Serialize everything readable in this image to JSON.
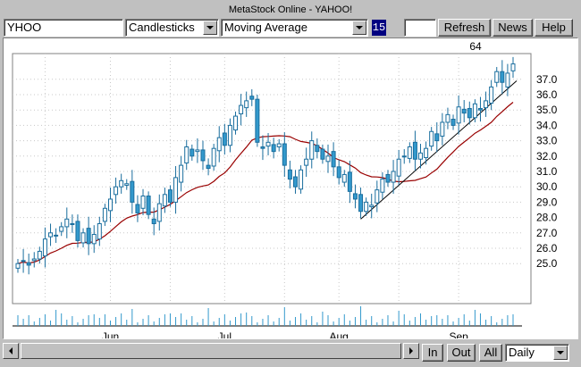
{
  "window": {
    "title": "MetaStock Online - YAHOO!"
  },
  "toolbar": {
    "symbol": "YHOO",
    "chart_style": "Candlesticks",
    "indicator": "Moving Average",
    "period": "15",
    "extra_value": "",
    "refresh_label": "Refresh",
    "news_label": "News",
    "help_label": "Help"
  },
  "footer": {
    "zoom_in_label": "In",
    "zoom_out_label": "Out",
    "all_label": "All",
    "interval": "Daily"
  },
  "colors": {
    "candle_up": "#ffffff",
    "candle_down": "#3399cc",
    "candle_outline": "#1a6e9e",
    "moving_average": "#990000",
    "trendline": "#000000",
    "grid": "#c8c8c8",
    "volume": "#3399cc"
  },
  "chart_data": {
    "type": "candlestick",
    "symbol": "YHOO",
    "interval": "Daily",
    "overlay": {
      "type": "moving_average",
      "period": 15
    },
    "period_label": "64",
    "x_tick_labels": [
      "Jun",
      "Jul",
      "Aug",
      "Sep"
    ],
    "y_ticks": [
      25.0,
      26.0,
      27.0,
      28.0,
      29.0,
      30.0,
      31.0,
      32.0,
      33.0,
      34.0,
      35.0,
      36.0,
      37.0
    ],
    "y_tick_labels": [
      "25.0",
      "26.0",
      "27.0",
      "28.0",
      "29.0",
      "30.0",
      "31.0",
      "32.0",
      "33.0",
      "34.0",
      "35.0",
      "36.0",
      "37.0"
    ],
    "ylim": [
      23.5,
      38.5
    ],
    "grid": true,
    "close": [
      25.0,
      25.2,
      24.9,
      25.3,
      25.8,
      26.6,
      27.0,
      26.8,
      27.4,
      27.9,
      27.6,
      26.5,
      27.0,
      26.3,
      26.9,
      27.6,
      28.6,
      29.2,
      30.0,
      30.4,
      30.2,
      29.0,
      28.3,
      29.4,
      28.2,
      27.6,
      28.9,
      29.5,
      29.0,
      30.6,
      31.4,
      32.6,
      32.0,
      32.4,
      31.7,
      31.2,
      32.5,
      33.2,
      32.7,
      34.0,
      34.6,
      35.3,
      35.6,
      35.7,
      32.9,
      32.5,
      32.9,
      32.3,
      32.8,
      31.4,
      30.5,
      30.0,
      31.1,
      31.8,
      33.0,
      32.3,
      31.8,
      32.0,
      31.3,
      30.6,
      30.8,
      29.7,
      29.2,
      28.4,
      29.0,
      28.8,
      29.8,
      30.5,
      30.3,
      31.0,
      31.8,
      32.0,
      32.6,
      31.8,
      32.2,
      32.5,
      33.6,
      33.0,
      34.2,
      34.7,
      34.0,
      35.2,
      34.8,
      34.5,
      35.4,
      35.0,
      35.6,
      36.5,
      37.5,
      36.8,
      37.4,
      38.0
    ]
  }
}
